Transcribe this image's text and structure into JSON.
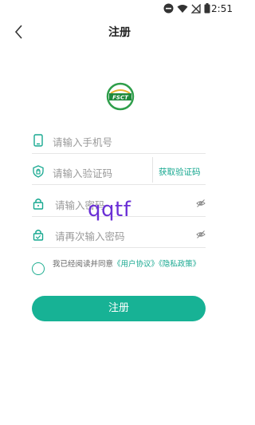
{
  "status_bar": {
    "time": "2:51"
  },
  "nav": {
    "title": "注册"
  },
  "form": {
    "phone": {
      "placeholder": "请输入手机号"
    },
    "code": {
      "placeholder": "请输入验证码",
      "send_label": "获取验证码"
    },
    "password": {
      "placeholder": "请输入密码"
    },
    "password_confirm": {
      "placeholder": "请再次输入密码"
    }
  },
  "watermark": "qqtf",
  "agreement": {
    "prefix": "我已经阅读并同意",
    "user_agreement": "《用户协议》",
    "privacy_policy": "《隐私政策》"
  },
  "submit": {
    "label": "注册"
  },
  "colors": {
    "accent": "#17b295",
    "link": "#17a890",
    "logo_text": "FSCT"
  }
}
